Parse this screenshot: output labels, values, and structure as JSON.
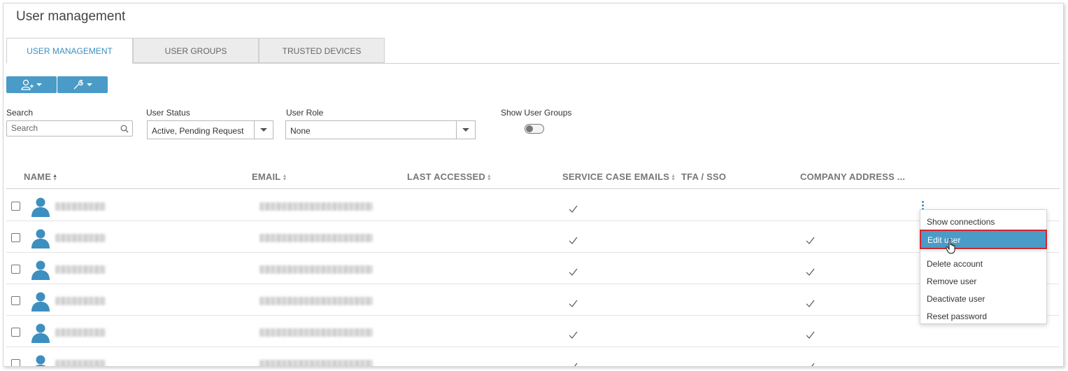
{
  "page": {
    "title": "User management"
  },
  "tabs": [
    {
      "label": "USER MANAGEMENT",
      "active": true
    },
    {
      "label": "USER GROUPS",
      "active": false
    },
    {
      "label": "TRUSTED DEVICES",
      "active": false
    }
  ],
  "toolbar": {
    "add_user_icon": "add-user-icon",
    "tools_icon": "wrench-icon",
    "accent": "#4a9bc7"
  },
  "filters": {
    "search": {
      "label": "Search",
      "placeholder": "Search"
    },
    "user_status": {
      "label": "User Status",
      "value": "Active, Pending Request"
    },
    "user_role": {
      "label": "User Role",
      "value": "None"
    },
    "show_user_groups": {
      "label": "Show User Groups",
      "on": false
    }
  },
  "table": {
    "columns": [
      "NAME",
      "EMAIL",
      "LAST ACCESSED",
      "SERVICE CASE EMAILS",
      "TFA / SSO",
      "COMPANY ADDRESS ..."
    ],
    "rows": [
      {
        "service_case_emails": true,
        "company_address": false
      },
      {
        "service_case_emails": true,
        "company_address": true
      },
      {
        "service_case_emails": true,
        "company_address": true
      },
      {
        "service_case_emails": true,
        "company_address": true
      },
      {
        "service_case_emails": true,
        "company_address": true
      },
      {
        "service_case_emails": true,
        "company_address": true
      }
    ]
  },
  "context_menu": {
    "items": [
      "Show connections",
      "Edit user",
      "Delete account",
      "Remove user",
      "Deactivate user",
      "Reset password"
    ],
    "selected": "Edit user",
    "highlight": "#d3262e"
  }
}
